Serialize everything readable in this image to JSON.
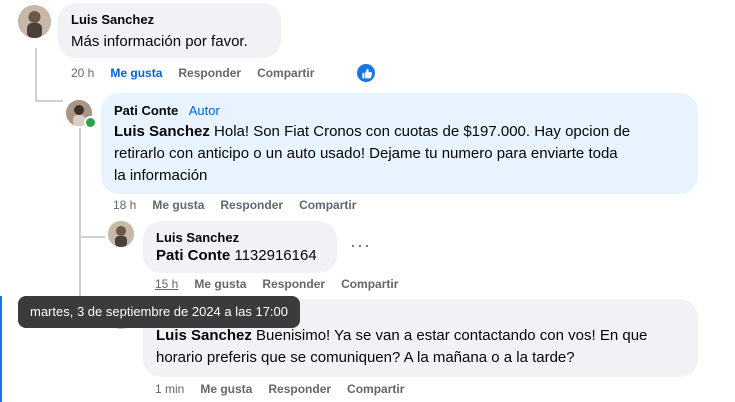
{
  "comment1": {
    "author": "Luis Sanchez",
    "text": "Más información por favor.",
    "time": "20 h",
    "like": "Me gusta",
    "reply": "Responder",
    "share": "Compartir",
    "reaction_icon": "like-reaction-icon"
  },
  "reply1": {
    "author": "Pati Conte",
    "badge": "Autor",
    "mention": "Luis Sanchez",
    "text_line1": " Hola! Son Fiat Cronos con cuotas de $197.000. Hay opcion de",
    "text_line2": "retirarlo con anticipo o un auto usado! Dejame tu numero para enviarte toda",
    "text_line3": "la información",
    "time": "18 h",
    "like": "Me gusta",
    "reply": "Responder",
    "share": "Compartir"
  },
  "reply2": {
    "author": "Luis Sanchez",
    "mention": "Pati Conte",
    "text": " 1132916164",
    "time": "15 h",
    "like": "Me gusta",
    "reply": "Responder",
    "share": "Compartir",
    "more": "···"
  },
  "reply3": {
    "mention": "Luis Sanchez",
    "text_line1": " Buenisimo! Ya se van a estar contactando con vos! En que",
    "text_line2": "horario preferis que se comuniquen? A la mañana o a la tarde?",
    "time": "1 min",
    "like": "Me gusta",
    "reply": "Responder",
    "share": "Compartir"
  },
  "tooltip": {
    "text": "martes, 3 de septiembre de 2024 a las 17:00"
  }
}
